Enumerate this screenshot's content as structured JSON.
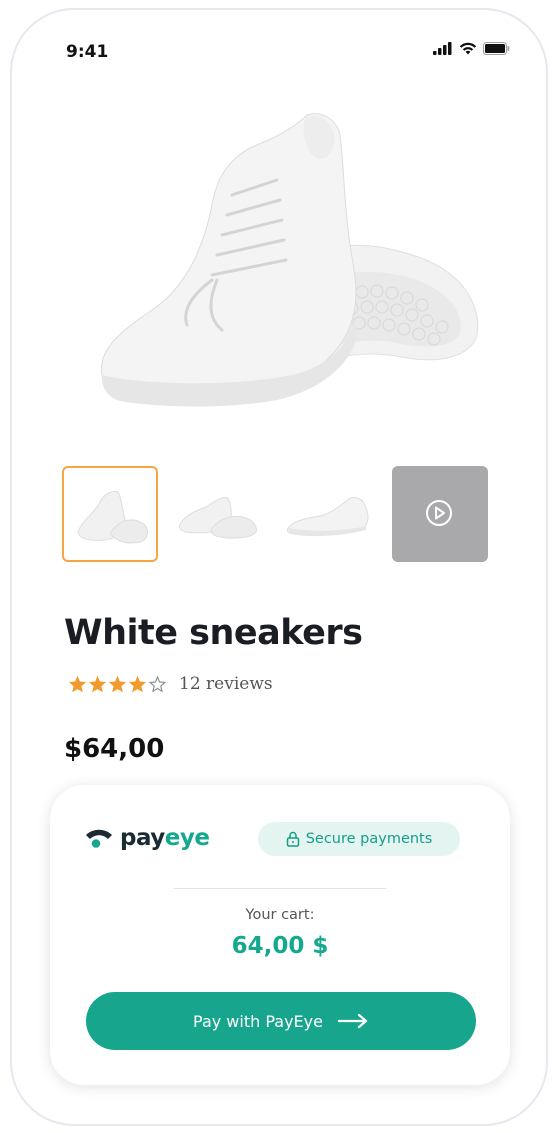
{
  "status_bar": {
    "time": "9:41"
  },
  "product": {
    "title": "White sneakers",
    "rating": 4,
    "rating_max": 5,
    "reviews": "12 reviews",
    "price": "$64,00",
    "thumbnails": [
      {
        "kind": "image",
        "selected": true
      },
      {
        "kind": "image",
        "selected": false
      },
      {
        "kind": "image",
        "selected": false
      },
      {
        "kind": "video",
        "selected": false,
        "icon": "play-icon"
      }
    ]
  },
  "checkout": {
    "brand_pay": "pay",
    "brand_eye": "eye",
    "secure_label": "Secure payments",
    "cart_label": "Your cart:",
    "cart_total": "64,00 $",
    "pay_button": "Pay with PayEye"
  },
  "colors": {
    "accent": "#17a68d",
    "star": "#f39a2c",
    "thumb_selected": "#f6a640",
    "secure_bg": "#e4f5f1"
  }
}
